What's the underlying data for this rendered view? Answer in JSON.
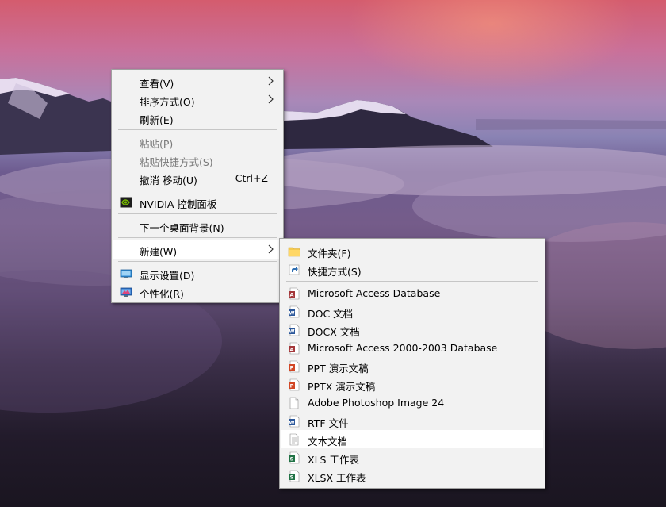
{
  "main_menu": [
    {
      "label": "查看(V)",
      "submenu": true
    },
    {
      "label": "排序方式(O)",
      "submenu": true
    },
    {
      "label": "刷新(E)"
    },
    {
      "label": "粘贴(P)",
      "disabled": true
    },
    {
      "label": "粘贴快捷方式(S)",
      "disabled": true
    },
    {
      "label": "撤消 移动(U)",
      "accel": "Ctrl+Z"
    },
    {
      "label": "NVIDIA 控制面板",
      "icon": "nvidia-icon"
    },
    {
      "label": "下一个桌面背景(N)"
    },
    {
      "label": "新建(W)",
      "submenu": true,
      "highlighted": true
    },
    {
      "label": "显示设置(D)",
      "icon": "display-icon"
    },
    {
      "label": "个性化(R)",
      "icon": "personalize-icon"
    }
  ],
  "new_submenu": [
    {
      "label": "文件夹(F)",
      "icon": "folder-icon"
    },
    {
      "label": "快捷方式(S)",
      "icon": "shortcut-icon"
    },
    {
      "label": "Microsoft Access Database",
      "icon": "access-icon"
    },
    {
      "label": "DOC 文档",
      "icon": "word-icon"
    },
    {
      "label": "DOCX 文档",
      "icon": "word-icon"
    },
    {
      "label": "Microsoft Access 2000-2003 Database",
      "icon": "access-icon"
    },
    {
      "label": "PPT 演示文稿",
      "icon": "powerpoint-icon"
    },
    {
      "label": "PPTX 演示文稿",
      "icon": "powerpoint-icon"
    },
    {
      "label": "Adobe Photoshop Image 24",
      "icon": "blank-file-icon"
    },
    {
      "label": "RTF 文件",
      "icon": "word-icon"
    },
    {
      "label": "文本文档",
      "icon": "text-file-icon",
      "highlighted": true
    },
    {
      "label": "XLS 工作表",
      "icon": "excel-icon"
    },
    {
      "label": "XLSX 工作表",
      "icon": "excel-icon"
    }
  ],
  "colors": {
    "menu_bg": "#f2f2f2",
    "menu_highlight": "#ffffff",
    "disabled_text": "#7a7a7a",
    "separator": "#c6c6c6"
  }
}
